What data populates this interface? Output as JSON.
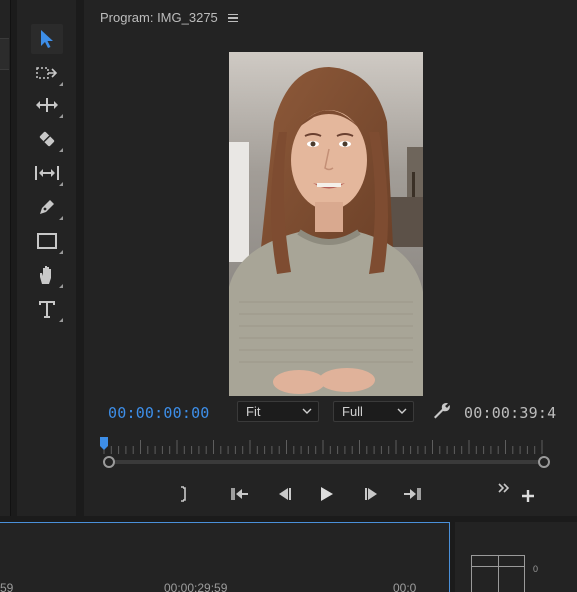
{
  "monitor": {
    "title": "Program: IMG_3275",
    "current_timecode": "00:00:00:00",
    "duration_timecode": "00:00:39:4",
    "zoom_select": "Fit",
    "resolution_select": "Full"
  },
  "tools": [
    {
      "name": "selection-tool",
      "icon": "arrow-cursor-icon",
      "active": true
    },
    {
      "name": "track-select-tool",
      "icon": "track-select-icon"
    },
    {
      "name": "ripple-edit-tool",
      "icon": "ripple-edit-icon"
    },
    {
      "name": "razor-tool",
      "icon": "razor-icon"
    },
    {
      "name": "slip-tool",
      "icon": "slip-icon"
    },
    {
      "name": "pen-tool",
      "icon": "pen-icon"
    },
    {
      "name": "rectangle-tool",
      "icon": "rectangle-icon"
    },
    {
      "name": "hand-tool",
      "icon": "hand-icon"
    },
    {
      "name": "type-tool",
      "icon": "type-icon"
    }
  ],
  "transport": {
    "buttons": [
      "mark-out",
      "go-to-in",
      "step-back",
      "play",
      "step-forward",
      "go-to-out",
      "more",
      "add-button"
    ]
  },
  "timeline": {
    "left_label": "59",
    "mid_label": "00:00:29:59",
    "right_label": "00:0"
  },
  "audio_meter": {
    "zero_label": "0"
  },
  "colors": {
    "accent": "#3d8ee8",
    "panel": "#232323",
    "background": "#1b1b1b"
  }
}
